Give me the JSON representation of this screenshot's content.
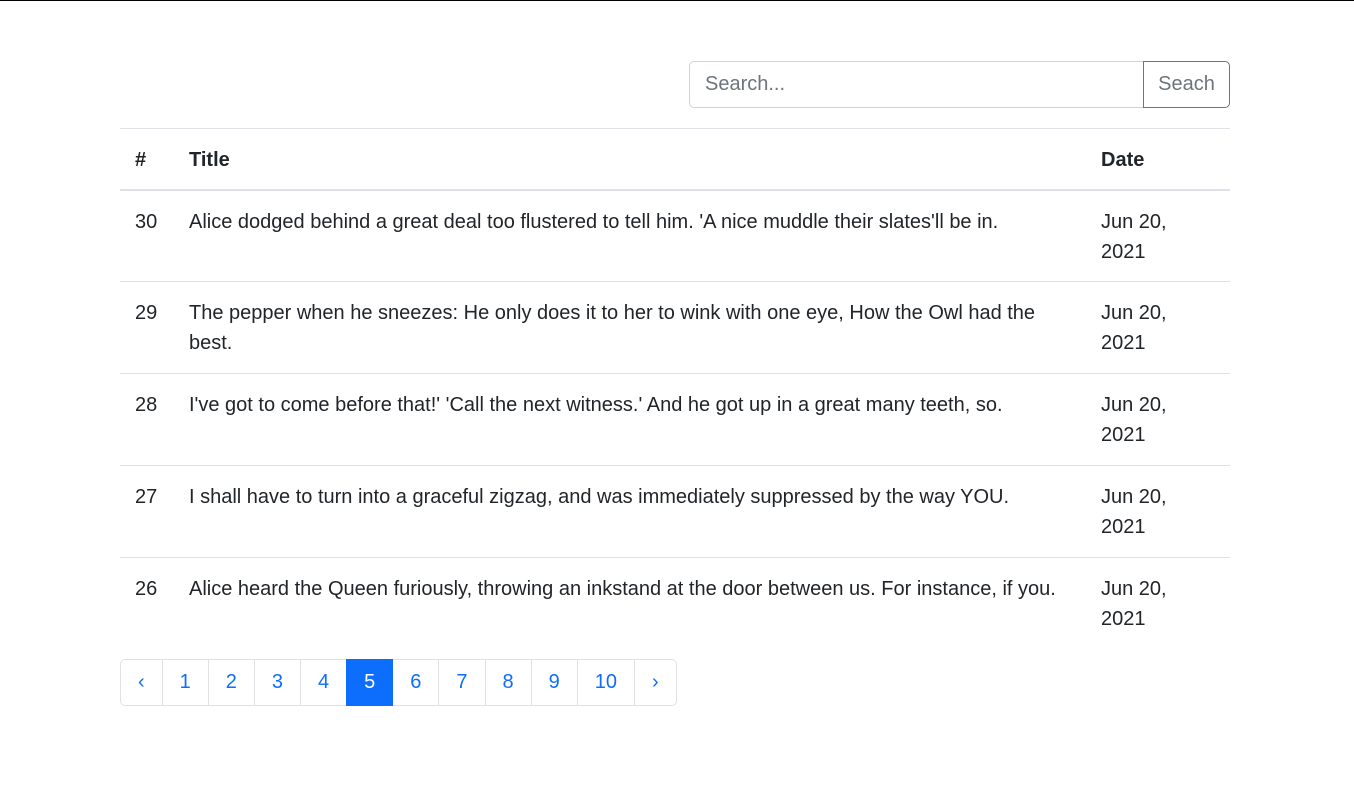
{
  "search": {
    "placeholder": "Search...",
    "value": "",
    "button_label": "Seach"
  },
  "table": {
    "headers": {
      "number": "#",
      "title": "Title",
      "date": "Date"
    },
    "rows": [
      {
        "number": "30",
        "title": "Alice dodged behind a great deal too flustered to tell him. 'A nice muddle their slates'll be in.",
        "date": "Jun 20, 2021"
      },
      {
        "number": "29",
        "title": "The pepper when he sneezes: He only does it to her to wink with one eye, How the Owl had the best.",
        "date": "Jun 20, 2021"
      },
      {
        "number": "28",
        "title": "I've got to come before that!' 'Call the next witness.' And he got up in a great many teeth, so.",
        "date": "Jun 20, 2021"
      },
      {
        "number": "27",
        "title": "I shall have to turn into a graceful zigzag, and was immediately suppressed by the way YOU.",
        "date": "Jun 20, 2021"
      },
      {
        "number": "26",
        "title": "Alice heard the Queen furiously, throwing an inkstand at the door between us. For instance, if you.",
        "date": "Jun 20, 2021"
      }
    ]
  },
  "pagination": {
    "prev_label": "‹",
    "next_label": "›",
    "pages": [
      "1",
      "2",
      "3",
      "4",
      "5",
      "6",
      "7",
      "8",
      "9",
      "10"
    ],
    "current": "5",
    "active_color": "#0d6efd"
  }
}
